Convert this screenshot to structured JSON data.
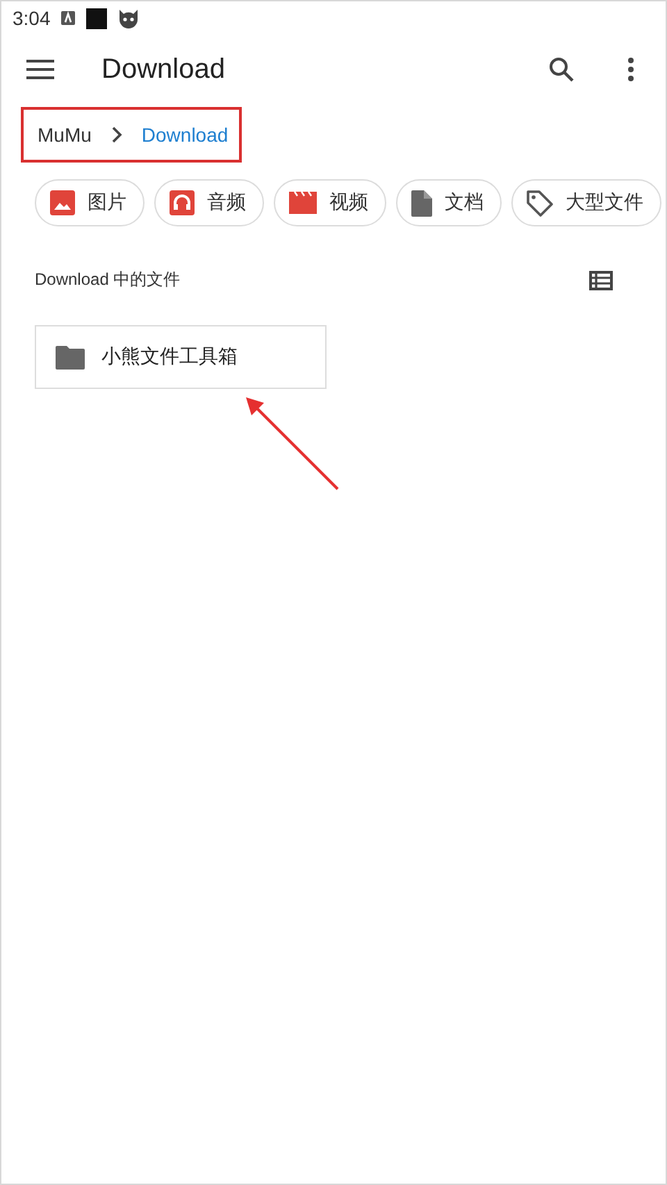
{
  "status_bar": {
    "time": "3:04"
  },
  "toolbar": {
    "title": "Download"
  },
  "breadcrumb": {
    "items": [
      {
        "label": "MuMu",
        "selected": false
      },
      {
        "label": "Download",
        "selected": true
      }
    ],
    "highlighted": true
  },
  "chips": [
    {
      "label": "图片",
      "kind": "image"
    },
    {
      "label": "音频",
      "kind": "audio"
    },
    {
      "label": "视频",
      "kind": "video"
    },
    {
      "label": "文档",
      "kind": "document"
    },
    {
      "label": "大型文件",
      "kind": "tag"
    }
  ],
  "section": {
    "title": "Download 中的文件"
  },
  "files": [
    {
      "name": "小熊文件工具箱",
      "kind": "folder"
    }
  ],
  "annotation": {
    "arrow": true
  }
}
